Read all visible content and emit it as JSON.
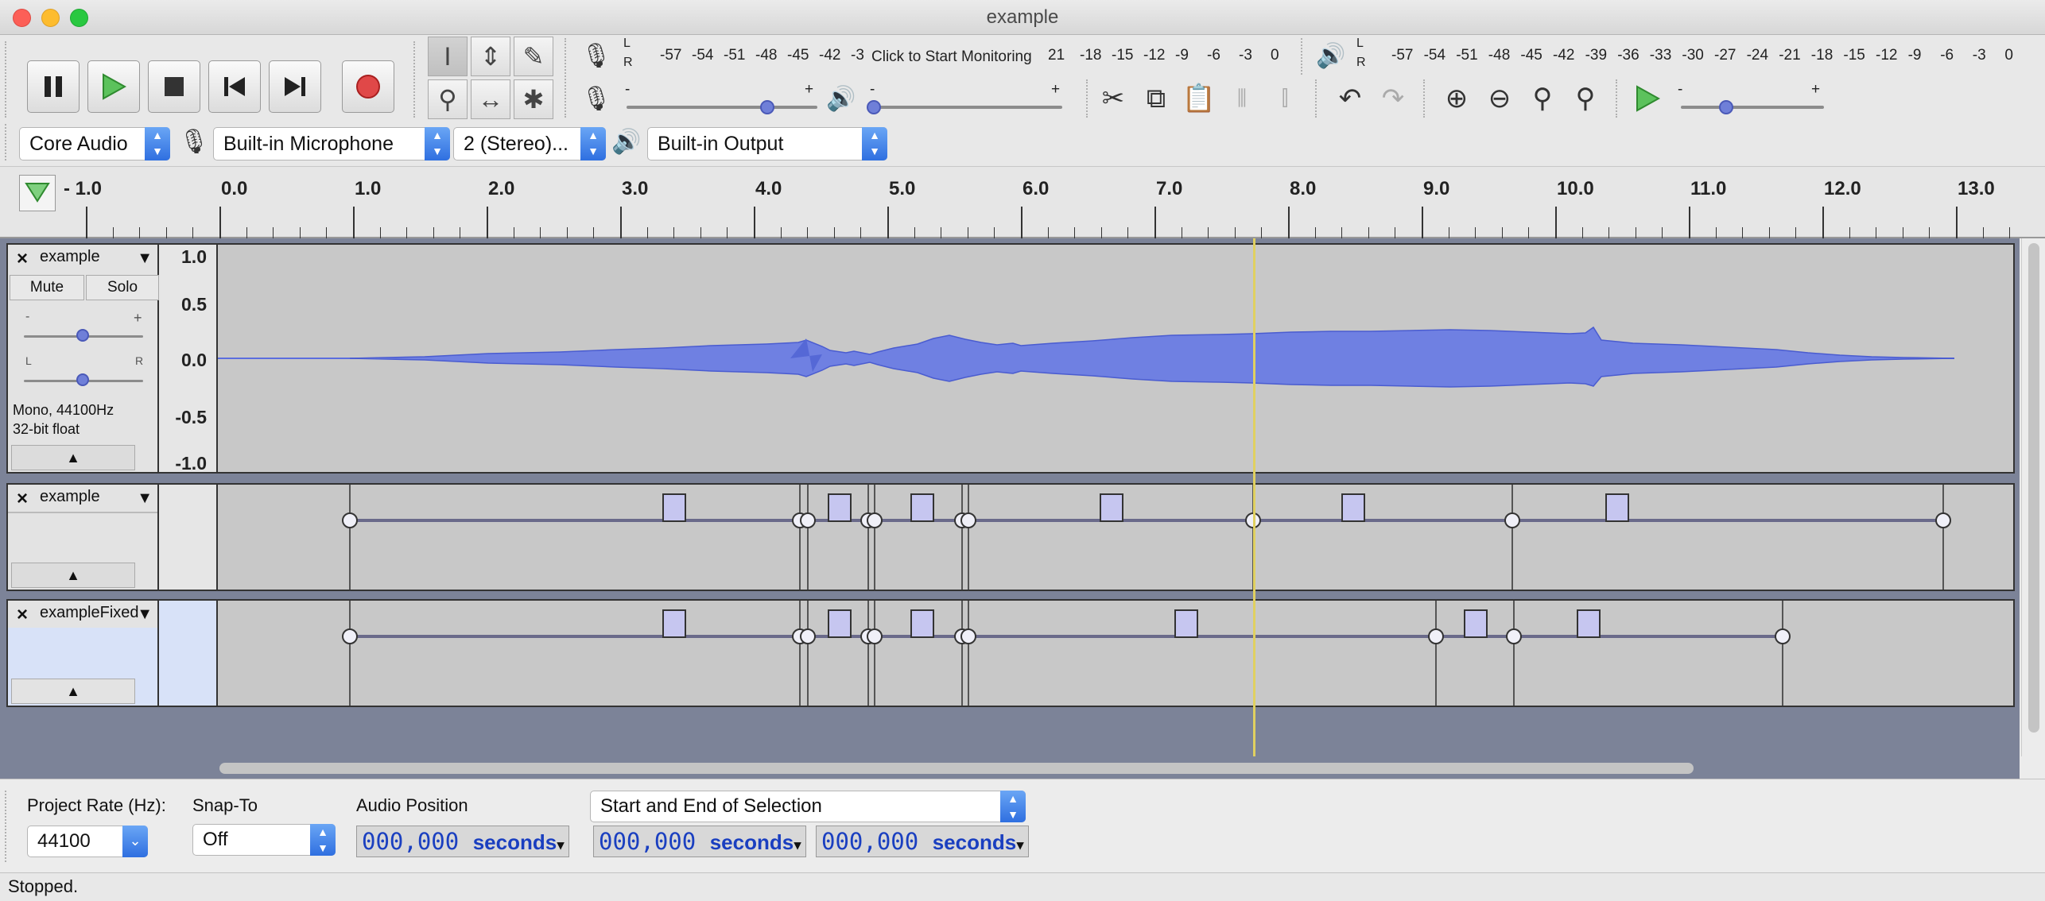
{
  "window": {
    "title": "example"
  },
  "transport": {
    "buttons": [
      "pause",
      "play",
      "stop",
      "skip-start",
      "skip-end",
      "record"
    ]
  },
  "meters": {
    "record_scale": [
      "-57",
      "-54",
      "-51",
      "-48",
      "-45",
      "-42",
      "-3"
    ],
    "record_prompt": "Click to Start Monitoring",
    "record_scale_right": [
      "21",
      "-18",
      "-15",
      "-12",
      "-9",
      "-6",
      "-3",
      "0"
    ],
    "play_scale": [
      "-57",
      "-54",
      "-51",
      "-48",
      "-45",
      "-42",
      "-39",
      "-36",
      "-33",
      "-30",
      "-27",
      "-24",
      "-21",
      "-18",
      "-15",
      "-12",
      "-9",
      "-6",
      "-3",
      "0"
    ],
    "lr": [
      "L",
      "R"
    ],
    "minus": "-",
    "plus": "+"
  },
  "device": {
    "host": "Core Audio",
    "input": "Built-in Microphone",
    "channels": "2 (Stereo)...",
    "output": "Built-in Output"
  },
  "ruler": {
    "labels": [
      "- 1.0",
      "0.0",
      "1.0",
      "2.0",
      "3.0",
      "4.0",
      "5.0",
      "6.0",
      "7.0",
      "8.0",
      "9.0",
      "10.0",
      "11.0",
      "12.0",
      "13.0"
    ]
  },
  "tracks": [
    {
      "name": "example",
      "mute": "Mute",
      "solo": "Solo",
      "info1": "Mono, 44100Hz",
      "info2": "32-bit float",
      "gain_l": "-",
      "gain_r": "+",
      "pan_l": "L",
      "pan_r": "R",
      "scale": [
        "1.0",
        "0.5",
        "0.0",
        "-0.5",
        "-1.0"
      ]
    },
    {
      "name": "example"
    },
    {
      "name": "exampleFixed"
    }
  ],
  "selection_bar": {
    "project_rate_label": "Project Rate (Hz):",
    "project_rate": "44100",
    "snap_label": "Snap-To",
    "snap_value": "Off",
    "audio_position_label": "Audio Position",
    "selection_mode": "Start and End of Selection",
    "audio_position": {
      "digits": "000,000",
      "unit": "seconds"
    },
    "sel_start": {
      "digits": "000,000",
      "unit": "seconds"
    },
    "sel_end": {
      "digits": "000,000",
      "unit": "seconds"
    }
  },
  "status": "Stopped.",
  "colors": {
    "waveform": "#5c6ede",
    "playhead": "#e0d060",
    "record": "#e04848",
    "play": "#3fae3f"
  }
}
